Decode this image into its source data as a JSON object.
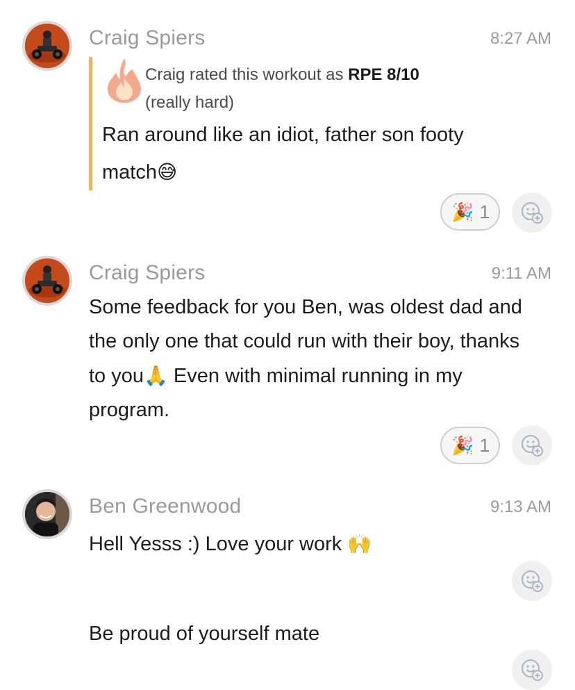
{
  "messages": [
    {
      "sender": "Craig Spiers",
      "time": "8:27 AM",
      "rpe_prefix": "Craig rated this workout as ",
      "rpe_value": "RPE 8/10",
      "rpe_desc": "(really hard)",
      "text": "Ran around like an idiot, father son footy match",
      "text_emoji": "😅",
      "reaction_emoji": "🎉",
      "reaction_count": "1"
    },
    {
      "sender": "Craig Spiers",
      "time": "9:11 AM",
      "text_part1": "Some feedback for you Ben, was oldest dad and the only one that could run with their boy, thanks to you",
      "text_emoji": "🙏",
      "text_part2": " Even with minimal running in my program.",
      "reaction_emoji": "🎉",
      "reaction_count": "1"
    },
    {
      "sender": "Ben Greenwood",
      "time": "9:13 AM",
      "text": "Hell Yesss :) Love your work ",
      "text_emoji": "🙌"
    },
    {
      "text": "Be proud of yourself mate"
    }
  ],
  "icons": {
    "rpe": "fire-icon",
    "add_reaction": "add-reaction-icon"
  },
  "colors": {
    "accent_bar": "#f0b45a",
    "sender": "#9a9a9a",
    "text": "#1c1c1c"
  }
}
